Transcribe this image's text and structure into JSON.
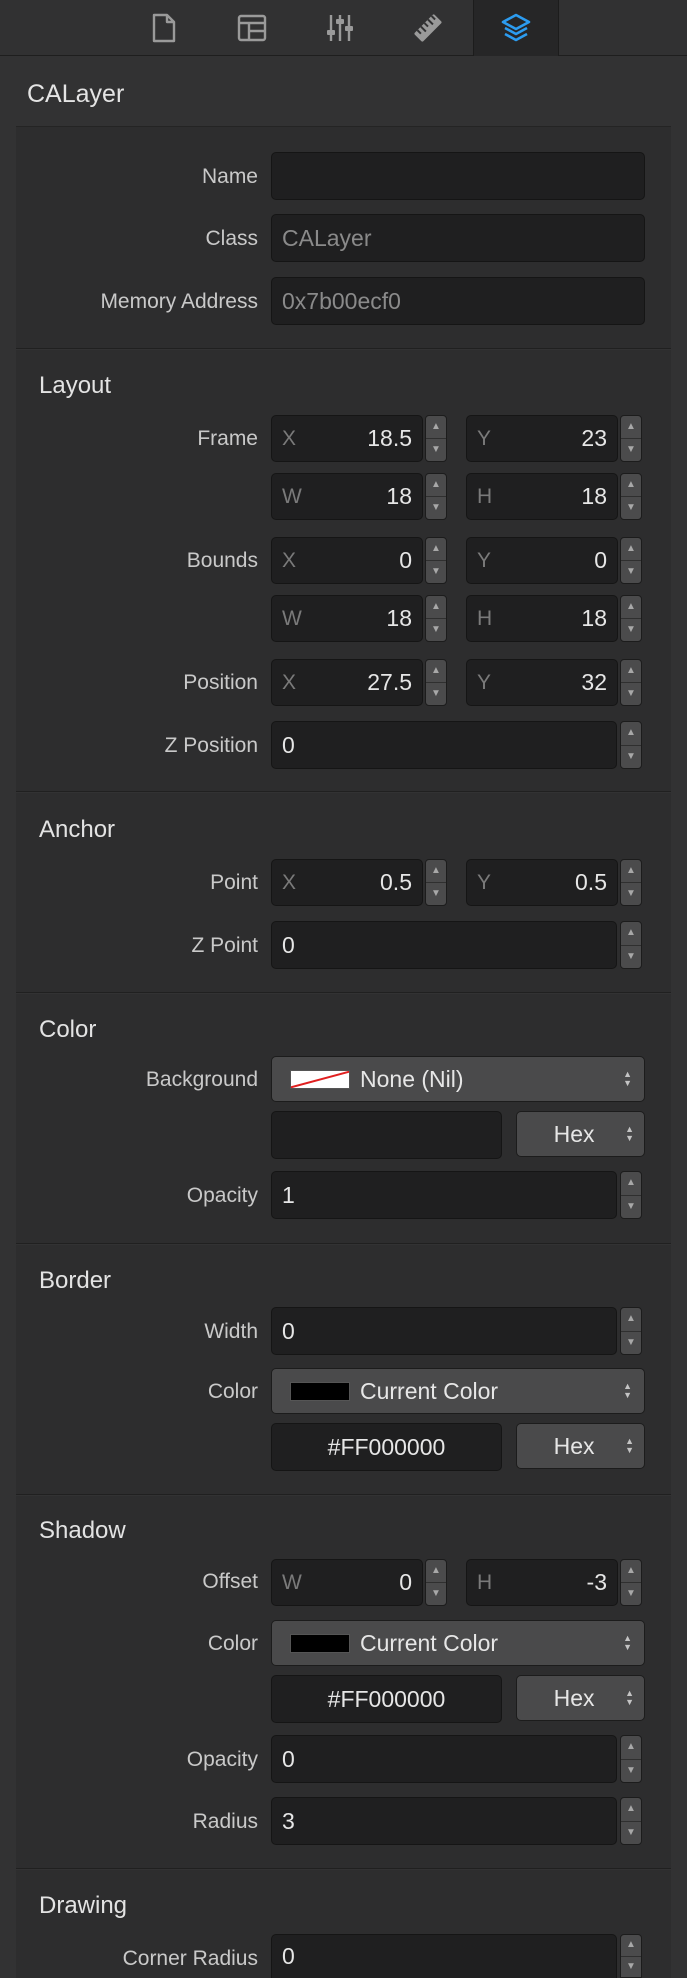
{
  "toolbar": {
    "tabs": [
      {
        "name": "file-icon"
      },
      {
        "name": "layout-icon"
      },
      {
        "name": "sliders-icon"
      },
      {
        "name": "ruler-icon"
      },
      {
        "name": "layers-icon",
        "active": true
      }
    ],
    "accent": "#2c9cf0"
  },
  "header": {
    "title": "CALayer"
  },
  "identity": {
    "name_label": "Name",
    "name_value": "",
    "class_label": "Class",
    "class_value": "CALayer",
    "address_label": "Memory Address",
    "address_value": "0x7b00ecf0"
  },
  "layout": {
    "title": "Layout",
    "frame_label": "Frame",
    "frame": {
      "x": "18.5",
      "y": "23",
      "w": "18",
      "h": "18"
    },
    "bounds_label": "Bounds",
    "bounds": {
      "x": "0",
      "y": "0",
      "w": "18",
      "h": "18"
    },
    "position_label": "Position",
    "position": {
      "x": "27.5",
      "y": "32"
    },
    "zposition_label": "Z Position",
    "zposition": "0"
  },
  "anchor": {
    "title": "Anchor",
    "point_label": "Point",
    "point": {
      "x": "0.5",
      "y": "0.5"
    },
    "zpoint_label": "Z Point",
    "zpoint": "0"
  },
  "color": {
    "title": "Color",
    "background_label": "Background",
    "background_value": "None (Nil)",
    "hex_value": "",
    "format": "Hex",
    "opacity_label": "Opacity",
    "opacity": "1"
  },
  "border": {
    "title": "Border",
    "width_label": "Width",
    "width": "0",
    "color_label": "Color",
    "color_value": "Current Color",
    "hex_value": "#FF000000",
    "format": "Hex"
  },
  "shadow": {
    "title": "Shadow",
    "offset_label": "Offset",
    "offset": {
      "w": "0",
      "h": "-3"
    },
    "color_label": "Color",
    "color_value": "Current Color",
    "hex_value": "#FF000000",
    "format": "Hex",
    "opacity_label": "Opacity",
    "opacity": "0",
    "radius_label": "Radius",
    "radius": "3"
  },
  "drawing": {
    "title": "Drawing",
    "corner_label": "Corner Radius",
    "corner": "0"
  },
  "axis": {
    "x": "X",
    "y": "Y",
    "w": "W",
    "h": "H"
  }
}
